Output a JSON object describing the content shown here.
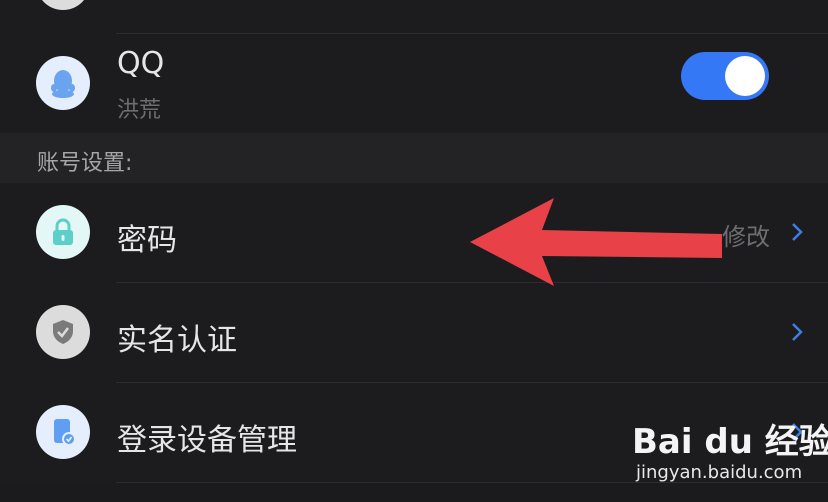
{
  "accounts": {
    "qq": {
      "title": "QQ",
      "subtitle": "洪荒",
      "toggle_on": true,
      "icon": "qq-penguin-icon"
    }
  },
  "section": {
    "label": "账号设置:"
  },
  "settings": [
    {
      "label": "密码",
      "trailing": "修改",
      "icon": "lock-icon",
      "icon_bg": "#e3f7f6",
      "icon_color": "#5ccfc8"
    },
    {
      "label": "实名认证",
      "icon": "shield-check-icon",
      "icon_bg": "#dcdcdc",
      "icon_color": "#7a7a7a"
    },
    {
      "label": "登录设备管理",
      "icon": "device-icon",
      "icon_bg": "#e4eefc",
      "icon_color": "#5f9ef0"
    }
  ],
  "colors": {
    "accent": "#3478f6",
    "arrow": "#e84148",
    "background": "#1c1c1e"
  },
  "watermark": {
    "main": "Bai du 经验",
    "sub": "jingyan.baidu.com"
  }
}
